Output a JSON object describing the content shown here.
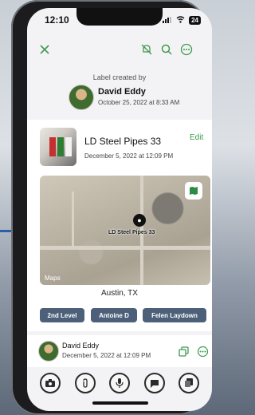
{
  "status_bar": {
    "time": "12:10",
    "signal_icon": "signal-icon",
    "wifi_icon": "wifi-icon",
    "battery": "24"
  },
  "top_bar": {
    "close_icon": "close-icon",
    "mute_icon": "bell-slash-icon",
    "search_icon": "search-icon",
    "more_icon": "more-icon"
  },
  "label_header": {
    "title": "Label created by",
    "creator_name": "David Eddy",
    "created_at": "October 25, 2022 at 8:33 AM"
  },
  "item": {
    "title": "LD Steel Pipes 33",
    "date": "December 5, 2022 at 12:09 PM",
    "edit_label": "Edit"
  },
  "map": {
    "pin_label": "LD Steel Pipes 33",
    "logo": "Maps",
    "location": "Austin, TX",
    "layer_icon": "map-icon"
  },
  "tags": [
    "2nd Level",
    "Antoine D",
    "Felen Laydown"
  ],
  "comment": {
    "author": "David Eddy",
    "date": "December 5, 2022 at 12:09 PM",
    "copy_icon": "copy-icon",
    "more_icon": "more-icon"
  },
  "toolbar": {
    "buttons": [
      "camera-icon",
      "attachment-icon",
      "microphone-icon",
      "message-icon",
      "copy-icon"
    ]
  },
  "colors": {
    "accent": "#3e9a4f",
    "tag_bg": "#4d6079"
  }
}
